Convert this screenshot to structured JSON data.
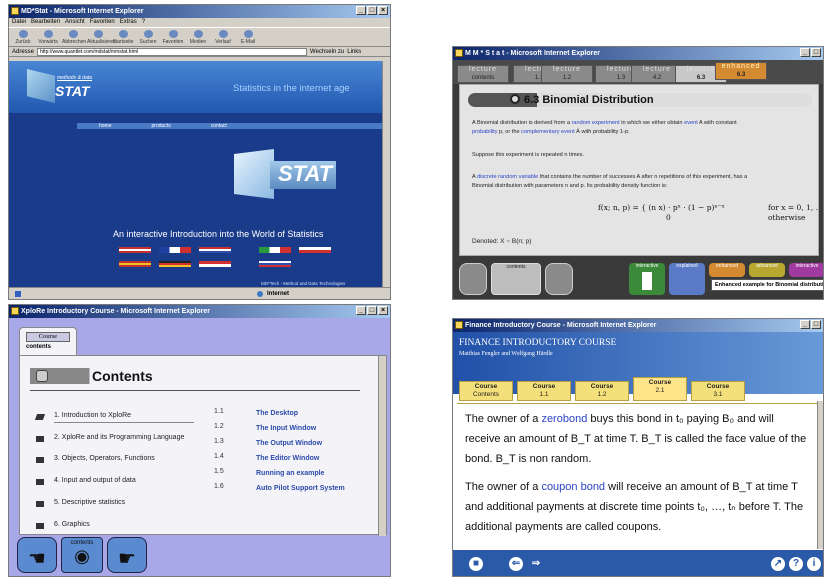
{
  "window1": {
    "title": "MD*Stat - Microsoft Internet Explorer",
    "menu": [
      "Datei",
      "Bearbeiten",
      "Ansicht",
      "Favoriten",
      "Extras",
      "?"
    ],
    "toolbar": [
      "Zurück",
      "Vorwärts",
      "Abbrechen",
      "Aktualisieren",
      "Startseite",
      "Suchen",
      "Favoriten",
      "Medien",
      "Verlauf",
      "E-Mail"
    ],
    "address_label": "Adresse",
    "address_value": "http://www.quantlet.com/mdstat/mmstat.html",
    "go_label": "Wechseln zu",
    "links_label": "Links",
    "logo_small_text": "methods & data",
    "logo_stat": "STAT",
    "banner": "Statistics in the internet age",
    "nav": [
      "home",
      "products",
      "contact"
    ],
    "big_logo": "STAT",
    "intro": "An interactive Introduction into the World of Statistics",
    "footer": "MD*Tech - Method and Data Technologies",
    "status_zone": "Internet"
  },
  "window2": {
    "title": "M M * S t a t - Microsoft Internet Explorer",
    "tabs": [
      {
        "label": "lecture",
        "sub": "contents"
      },
      {
        "label": "lecture",
        "sub": "1.1"
      },
      {
        "label": "lecture",
        "sub": "1.2"
      },
      {
        "label": "lecture",
        "sub": "1.3"
      },
      {
        "label": "lecture",
        "sub": "4.2"
      },
      {
        "label": "lecture",
        "sub": "6.3"
      },
      {
        "label": "enhanced",
        "sub": "6.3"
      }
    ],
    "heading": "6.3 Binomial Distribution",
    "para1_a": "A Binomial distribution is derived from a ",
    "para1_link1": "random experiment",
    "para1_b": " in which we either obtain ",
    "para1_link2": "event",
    "para1_c": " A with constant",
    "para1_link3": "probability",
    "para1_d": " p, or the ",
    "para1_link4": "complementary event",
    "para1_e": " Ā with probability 1-p.",
    "para2": "Suppose this experiment is repeated n times.",
    "para3_a": "A ",
    "para3_link": "discrete random variable",
    "para3_b": " that contains the number of successes A after n repetitions of this experiment, has a",
    "para3_c": "Binomial distribution with parameters n and p. Its probability density function is:",
    "formula_left": "f(x; n, p) = { (n x) · pˣ · (1 − p)ⁿ⁻ˣ",
    "formula_left2": "0",
    "formula_right1": "for x = 0, 1, …, n",
    "formula_right2": "otherwise",
    "denoted": "Denoted: X ~ B(n; p)",
    "buttons": [
      "contents",
      "interactive",
      "explained",
      "enhanced",
      "advanced",
      "interactive"
    ],
    "status_link": "Enhanced example for Binomial distribution"
  },
  "window3": {
    "title": "XploRe Introductory Course - Microsoft Internet Explorer",
    "tab_label": "Course",
    "tab_sub": "contents",
    "heading": "Contents",
    "items": [
      "1. Introduction to XploRe",
      "2. XploRe and its Programming Language",
      "3. Objects, Operators, Functions",
      "4. Input and output of data",
      "5. Descriptive statistics",
      "6. Graphics"
    ],
    "sub_numbers": [
      "1.1",
      "1.2",
      "1.3",
      "1.4",
      "1.5",
      "1.6"
    ],
    "sub_items": [
      "The Desktop",
      "The Input Window",
      "The Output Window",
      "The Editor Window",
      "Running an example",
      "Auto Pilot Support System"
    ],
    "bottom_label": "contents"
  },
  "window4": {
    "title": "Finance Introductory Course - Microsoft Internet Explorer",
    "course_title": "FINANCE INTRODUCTORY COURSE",
    "authors": "Matthias Fengler and Wolfgang Härdle",
    "tabs": [
      {
        "label": "Course",
        "sub": "Contents"
      },
      {
        "label": "Course",
        "sub": "1.1"
      },
      {
        "label": "Course",
        "sub": "1.2"
      },
      {
        "label": "Course",
        "sub": "2.1"
      },
      {
        "label": "Course",
        "sub": "3.1"
      }
    ],
    "p1_a": "The owner of a ",
    "p1_link": "zerobond",
    "p1_b": " buys this bond in t₀ paying B₀ and will",
    "p1_c": "receive an amount of B_T at time T. B_T is called the face value of the",
    "p1_d": "bond. B_T is non random.",
    "p2_a": "The owner of a ",
    "p2_link": "coupon bond",
    "p2_b": " will receive an amount of B_T at time T",
    "p2_c": "and additional payments at discrete time points t₀, …, tₙ before T. The",
    "p2_d": "additional payments are called coupons."
  }
}
